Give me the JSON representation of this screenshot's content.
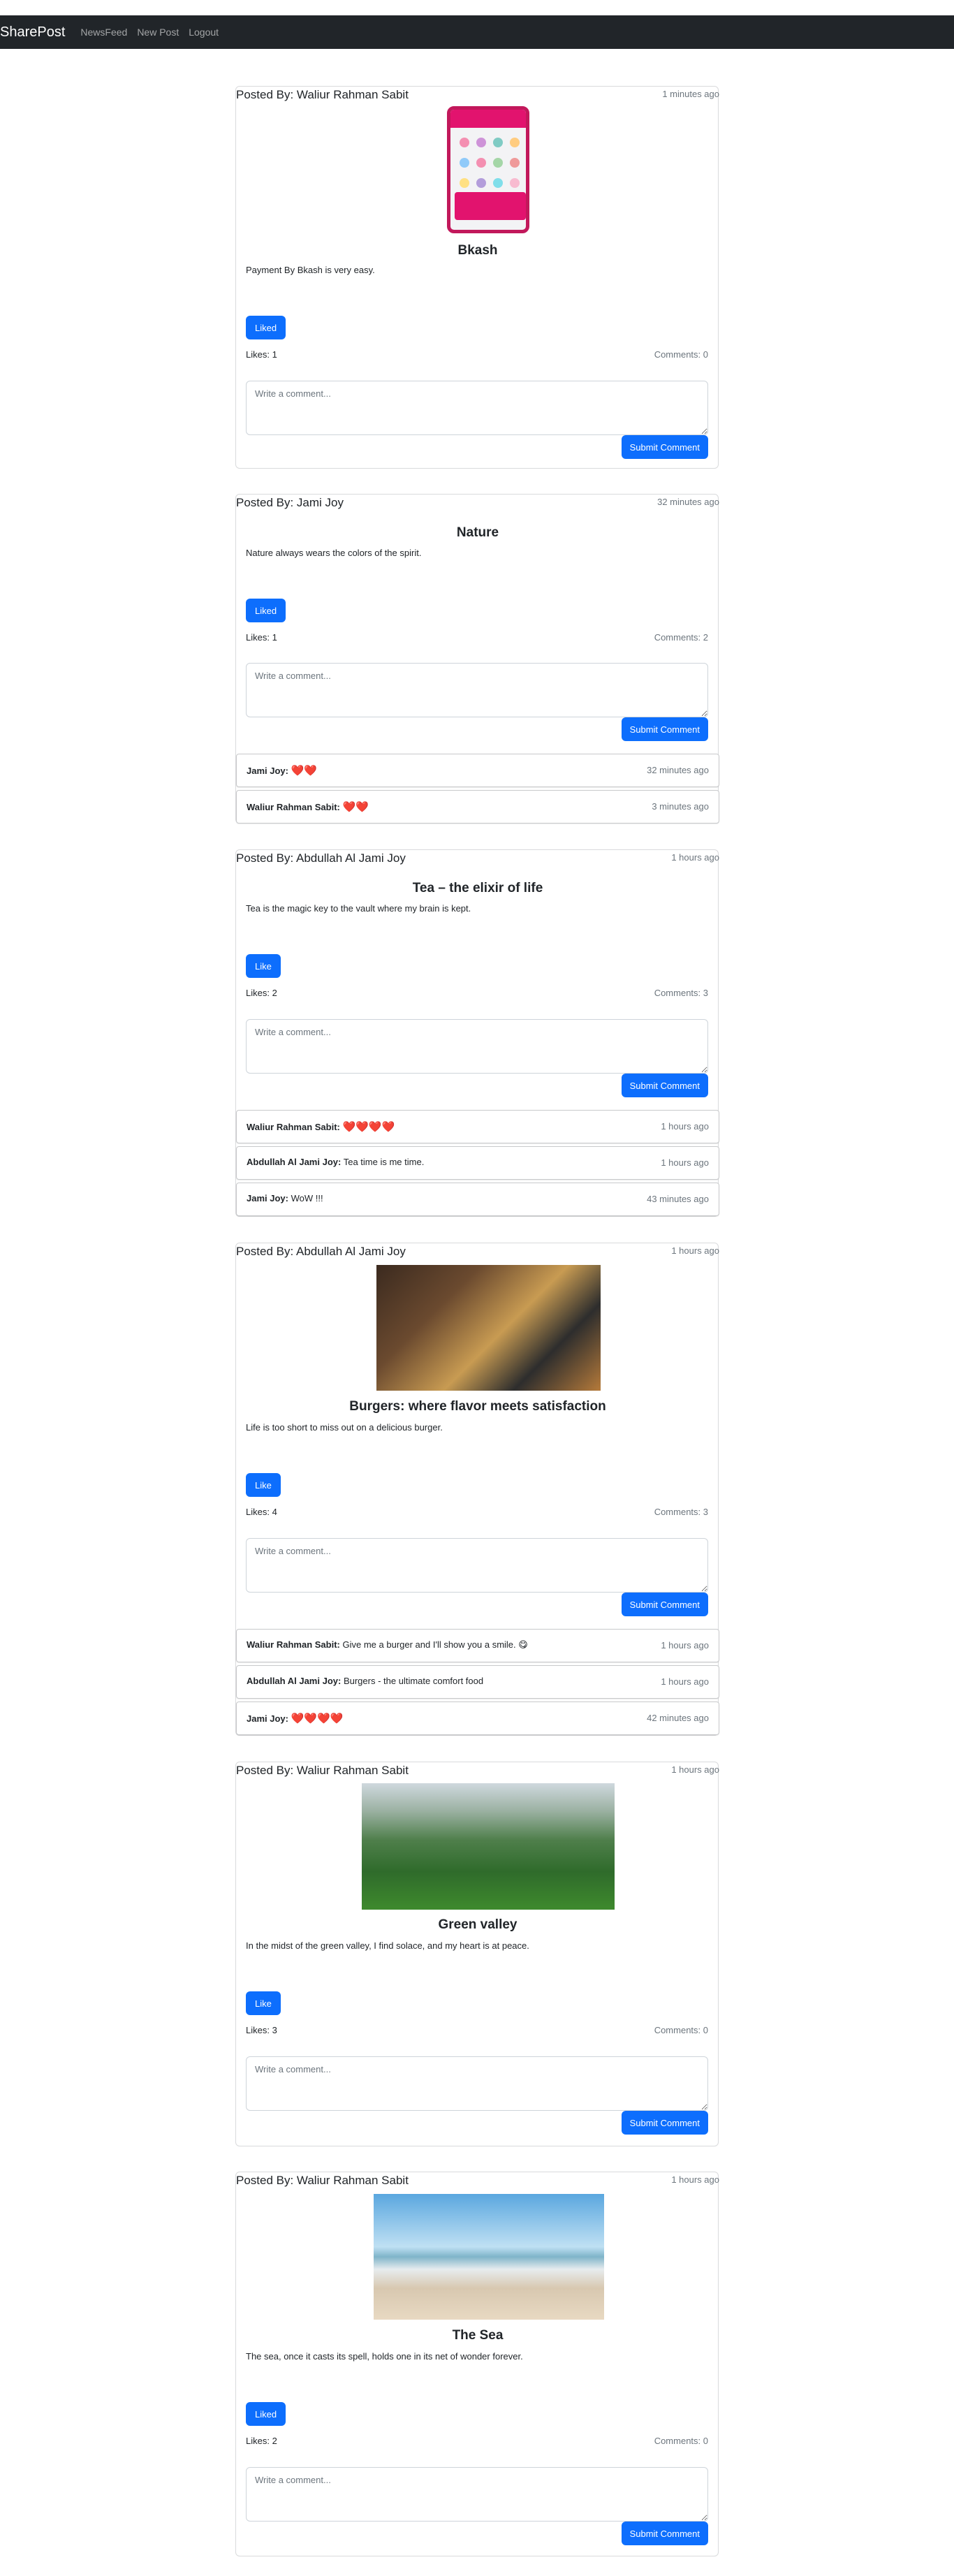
{
  "navbar": {
    "brand": "SharePost",
    "links": [
      "NewsFeed",
      "New Post",
      "Logout"
    ]
  },
  "common": {
    "comment_placeholder": "Write a comment...",
    "submit_label": "Submit Comment"
  },
  "posts": [
    {
      "posted_by": "Posted By: Waliur Rahman Sabit",
      "time": "1 minutes ago",
      "title": "Bkash",
      "body": "Payment By Bkash is very easy.",
      "like_label": "Liked",
      "likes": "Likes: 1",
      "comments_count": "Comments: 0"
    },
    {
      "posted_by": "Posted By: Jami Joy",
      "time": "32 minutes ago",
      "title": "Nature",
      "body": "Nature always wears the colors of the spirit.",
      "like_label": "Liked",
      "likes": "Likes: 1",
      "comments_count": "Comments: 2",
      "comments": [
        {
          "author": "Jami Joy:",
          "text": "❤️❤️",
          "time": "32 minutes ago"
        },
        {
          "author": "Waliur Rahman Sabit:",
          "text": "❤️❤️",
          "time": "3 minutes ago"
        }
      ]
    },
    {
      "posted_by": "Posted By: Abdullah Al Jami Joy",
      "time": "1 hours ago",
      "title": "Tea – the elixir of life",
      "body": "Tea is the magic key to the vault where my brain is kept.",
      "like_label": "Like",
      "likes": "Likes: 2",
      "comments_count": "Comments: 3",
      "comments": [
        {
          "author": "Waliur Rahman Sabit:",
          "text": "❤️❤️❤️❤️",
          "time": "1 hours ago"
        },
        {
          "author": "Abdullah Al Jami Joy:",
          "text": "Tea time is me time.",
          "time": "1 hours ago"
        },
        {
          "author": "Jami Joy:",
          "text": "WoW !!!",
          "time": "43 minutes ago"
        }
      ]
    },
    {
      "posted_by": "Posted By: Abdullah Al Jami Joy",
      "time": "1 hours ago",
      "title": "Burgers: where flavor meets satisfaction",
      "body": "Life is too short to miss out on a delicious burger.",
      "like_label": "Like",
      "likes": "Likes: 4",
      "comments_count": "Comments: 3",
      "comments": [
        {
          "author": "Waliur Rahman Sabit:",
          "text": "Give me a burger and I'll show you a smile. 😋",
          "time": "1 hours ago"
        },
        {
          "author": "Abdullah Al Jami Joy:",
          "text": "Burgers - the ultimate comfort food",
          "time": "1 hours ago"
        },
        {
          "author": "Jami Joy:",
          "text": "❤️❤️❤️❤️",
          "time": "42 minutes ago"
        }
      ]
    },
    {
      "posted_by": "Posted By: Waliur Rahman Sabit",
      "time": "1 hours ago",
      "title": "Green valley",
      "body": "In the midst of the green valley, I find solace, and my heart is at peace.",
      "like_label": "Like",
      "likes": "Likes: 3",
      "comments_count": "Comments: 0"
    },
    {
      "posted_by": "Posted By: Waliur Rahman Sabit",
      "time": "1 hours ago",
      "title": "The Sea",
      "body": "The sea, once it casts its spell, holds one in its net of wonder forever.",
      "like_label": "Liked",
      "likes": "Likes: 2",
      "comments_count": "Comments: 0"
    }
  ]
}
